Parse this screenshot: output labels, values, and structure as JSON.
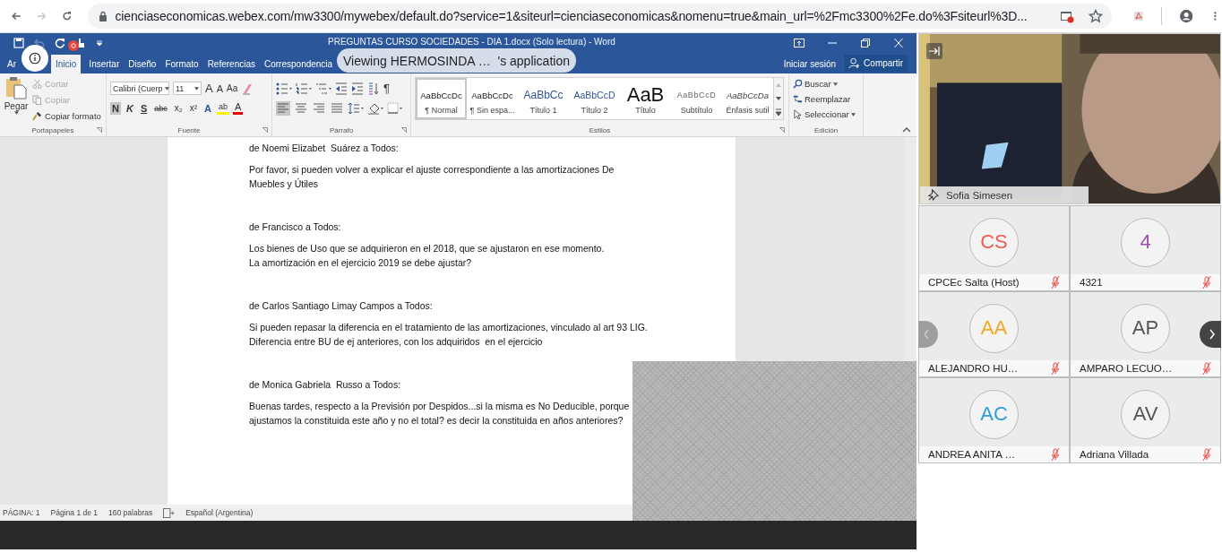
{
  "browser": {
    "nav": [
      {
        "kind": "back",
        "disabled": false
      },
      {
        "kind": "forward",
        "disabled": true
      },
      {
        "kind": "reload",
        "disabled": false
      }
    ],
    "url": "cienciaseconomicas.webex.com/mw3300/mywebex/default.do?service=1&siteurl=cienciaseconomicas&nomenu=true&main_url=%2Fmc3300%2Fe.do%3Fsiteurl%3D..."
  },
  "word": {
    "quick_access": [
      {
        "kind": "save",
        "disabled": false
      },
      {
        "kind": "undo",
        "disabled": true
      },
      {
        "kind": "redo",
        "disabled": false
      },
      {
        "kind": "touch",
        "disabled": false
      },
      {
        "kind": "customize",
        "disabled": false
      }
    ],
    "title": "PREGUNTAS CURSO SOCIEDADES - DIA 1.docx (Solo lectura) - Word",
    "tabs": [
      {
        "label": "Ar",
        "selected": false
      },
      {
        "label": "Inicio",
        "selected": true
      },
      {
        "label": "Insertar",
        "selected": false
      },
      {
        "label": "Diseño",
        "selected": false
      },
      {
        "label": "Formato",
        "selected": false
      },
      {
        "label": "Referencias",
        "selected": false
      },
      {
        "label": "Correspondencia",
        "selected": false
      }
    ],
    "sign_in": "Iniciar sesión",
    "share": "Compartir",
    "clipboard": {
      "group": "Portapapeles",
      "paste": "Pegar",
      "items": [
        {
          "label": "Cortar",
          "kind": "cut",
          "disabled": true
        },
        {
          "label": "Copiar",
          "kind": "copy",
          "disabled": true
        },
        {
          "label": "Copiar formato",
          "kind": "format-painter",
          "disabled": false
        }
      ]
    },
    "font": {
      "group": "Fuente",
      "name": "Calibri (Cuerp",
      "size": "11",
      "grow": "A",
      "shrink": "A",
      "case": "Aa",
      "styles": [
        {
          "label": "N",
          "kind": "bold",
          "on": true
        },
        {
          "label": "K",
          "kind": "italic",
          "on": false
        },
        {
          "label": "S",
          "kind": "underline",
          "on": false
        },
        {
          "label": "abc",
          "kind": "strike",
          "on": false
        },
        {
          "label": "x₂",
          "kind": "sub",
          "on": false
        },
        {
          "label": "x²",
          "kind": "sup",
          "on": false
        }
      ],
      "effects": "A",
      "highlight": "ab",
      "color_letter": "A"
    },
    "paragraph": {
      "group": "Párrafo",
      "pilcrow": "¶",
      "align": [
        {
          "kind": "left",
          "on": true
        },
        {
          "kind": "center",
          "on": false
        },
        {
          "kind": "right",
          "on": false
        },
        {
          "kind": "justify",
          "on": false
        }
      ]
    },
    "styles": {
      "group": "Estilos",
      "items": [
        {
          "sample": "AaBbCcDc",
          "name": "¶ Normal",
          "kind": "normal",
          "selected": true
        },
        {
          "sample": "AaBbCcDc",
          "name": "¶ Sin espa...",
          "kind": "nospace",
          "selected": false
        },
        {
          "sample": "AaBbCc",
          "name": "Título 1",
          "kind": "h1",
          "selected": false
        },
        {
          "sample": "AaBbCcD",
          "name": "Título 2",
          "kind": "h2",
          "selected": false
        },
        {
          "sample": "AaB",
          "name": "Título",
          "kind": "title",
          "selected": false
        },
        {
          "sample": "AaBbCcD",
          "name": "Subtítulo",
          "kind": "subtitle",
          "selected": false
        },
        {
          "sample": "AaBbCcDa",
          "name": "Énfasis sutil",
          "kind": "emphasis",
          "selected": false
        }
      ]
    },
    "editing": {
      "group": "Edición",
      "items": [
        {
          "label": "Buscar",
          "kind": "find"
        },
        {
          "label": "Reemplazar",
          "kind": "replace"
        },
        {
          "label": "Seleccionar",
          "kind": "select"
        }
      ]
    },
    "document": {
      "messages": [
        {
          "from": "de Noemi Elizabet  Suárez a Todos:",
          "lines": [
            "Por favor, si pueden volver a explicar el ajuste correspondiente a las amortizaciones De",
            "Muebles y Útiles"
          ]
        },
        {
          "from": "de Francisco a Todos:",
          "lines": [
            "Los bienes de Uso que se adquirieron en el 2018, que se ajustaron en ese momento.",
            "La amortización en el ejercicio 2019 se debe ajustar?"
          ]
        },
        {
          "from": "de Carlos Santiago Limay Campos a Todos:",
          "lines": [
            "Si pueden repasar la diferencia en el tratamiento de las amortizaciones, vinculado al art 93 LIG.",
            "Diferencia entre BU de ej anteriores, con los adquiridos  en el ejercicio"
          ]
        },
        {
          "from": "de Monica Gabriela  Russo a Todos:",
          "lines": [
            "Buenas tardes, respecto a la Previsión por Despidos...si la misma es No Deducible, porque",
            "ajustamos la constituida este año y no el total? es decir la constituida en años anteriores?"
          ]
        }
      ]
    },
    "status_bar": {
      "page": "PÁGINA: 1",
      "pages": "Página 1 de 1",
      "words": "160 palabras",
      "language": "Español (Argentina)"
    }
  },
  "share_banner": "Viewing HERMOSINDA …  's application",
  "video": {
    "name": "Sofia Simesen"
  },
  "participants": [
    {
      "initials": "CS",
      "color": "#ef5b4f",
      "name": "CPCEc Salta (Host)",
      "muted": true
    },
    {
      "initials": "4",
      "color": "#9b4db0",
      "name": "4321",
      "muted": true
    },
    {
      "initials": "AA",
      "color": "#f5a623",
      "name": "ALEJANDRO HU…",
      "muted": true
    },
    {
      "initials": "AP",
      "color": "#555555",
      "name": "AMPARO LECUO…",
      "muted": true
    },
    {
      "initials": "AC",
      "color": "#2d9cdb",
      "name": "ANDREA ANITA …",
      "muted": true
    },
    {
      "initials": "AV",
      "color": "#555555",
      "name": "Adriana Villada",
      "muted": true
    }
  ]
}
